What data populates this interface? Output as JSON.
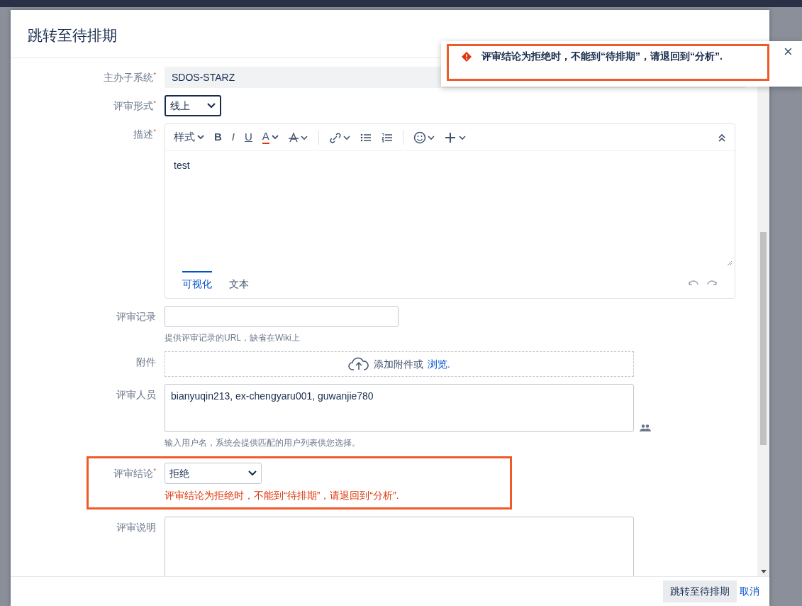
{
  "dialog": {
    "title": "跳转至待排期"
  },
  "fields": [
    {
      "kind": "readonly",
      "label": "主办子系统",
      "required_mark": "*",
      "value": "SDOS-STARZ"
    },
    {
      "kind": "select",
      "label": "评审形式",
      "required_mark": "*",
      "value": "线上",
      "focused": true
    },
    {
      "kind": "editor",
      "label": "描述",
      "required_mark": "*",
      "value": "test",
      "toolbar": [
        {
          "kind": "style",
          "label": "样式"
        },
        {
          "kind": "bold",
          "label": "B"
        },
        {
          "kind": "italic",
          "label": "I"
        },
        {
          "kind": "underline",
          "label": "U"
        },
        {
          "kind": "color",
          "label": "A"
        },
        {
          "kind": "clear"
        },
        {
          "kind": "link"
        },
        {
          "kind": "bullets"
        },
        {
          "kind": "numbers"
        },
        {
          "kind": "emoji"
        },
        {
          "kind": "plus"
        },
        {
          "kind": "collapse"
        }
      ],
      "tabs": [
        {
          "label": "可视化",
          "selected": true
        },
        {
          "label": "文本",
          "selected": false
        }
      ]
    },
    {
      "kind": "input",
      "label": "评审记录",
      "help": "提供评审记录的URL，缺省在Wiki上"
    },
    {
      "kind": "attachment",
      "label": "附件",
      "text": "添加附件或",
      "link": "浏览."
    },
    {
      "kind": "users",
      "label": "评审人员",
      "value": "bianyuqin213, ex-chengyaru001, guwanjie780",
      "help": "输入用户名，系统会提供匹配的用户列表供您选择。"
    },
    {
      "kind": "select",
      "label": "评审结论",
      "required_mark": "*",
      "value": "拒绝",
      "wide": true,
      "highlighted": true,
      "error": "评审结论为拒绝时，不能到“待排期”，请退回到“分析”."
    },
    {
      "kind": "textarea",
      "label": "评审说明"
    }
  ],
  "footer": {
    "submit": "跳转至待排期",
    "cancel": "取消"
  },
  "toast": {
    "message": "评审结论为拒绝时，不能到“待排期”，请退回到“分析”.",
    "close": "×",
    "highlighted": true
  }
}
